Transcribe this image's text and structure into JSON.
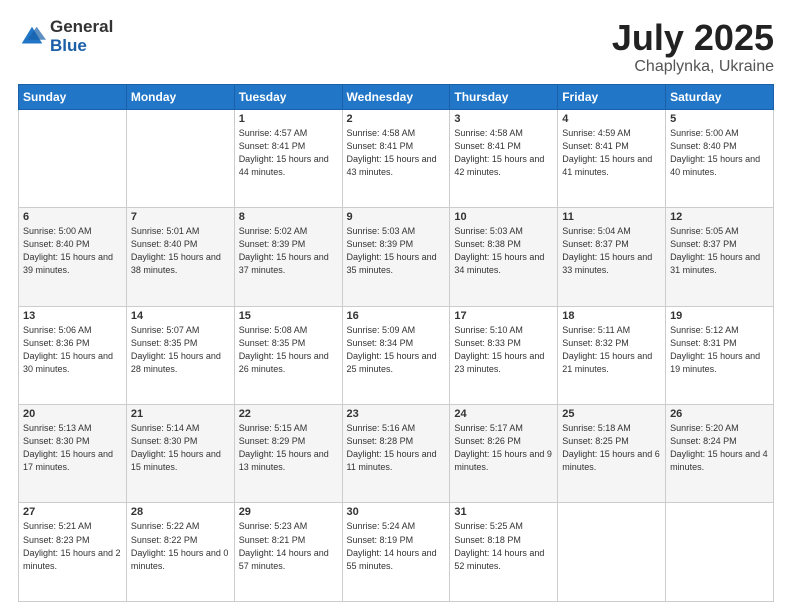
{
  "logo": {
    "general": "General",
    "blue": "Blue"
  },
  "title": {
    "month": "July 2025",
    "location": "Chaplynka, Ukraine"
  },
  "weekdays": [
    "Sunday",
    "Monday",
    "Tuesday",
    "Wednesday",
    "Thursday",
    "Friday",
    "Saturday"
  ],
  "weeks": [
    [
      {
        "day": "",
        "info": ""
      },
      {
        "day": "",
        "info": ""
      },
      {
        "day": "1",
        "info": "Sunrise: 4:57 AM\nSunset: 8:41 PM\nDaylight: 15 hours\nand 44 minutes."
      },
      {
        "day": "2",
        "info": "Sunrise: 4:58 AM\nSunset: 8:41 PM\nDaylight: 15 hours\nand 43 minutes."
      },
      {
        "day": "3",
        "info": "Sunrise: 4:58 AM\nSunset: 8:41 PM\nDaylight: 15 hours\nand 42 minutes."
      },
      {
        "day": "4",
        "info": "Sunrise: 4:59 AM\nSunset: 8:41 PM\nDaylight: 15 hours\nand 41 minutes."
      },
      {
        "day": "5",
        "info": "Sunrise: 5:00 AM\nSunset: 8:40 PM\nDaylight: 15 hours\nand 40 minutes."
      }
    ],
    [
      {
        "day": "6",
        "info": "Sunrise: 5:00 AM\nSunset: 8:40 PM\nDaylight: 15 hours\nand 39 minutes."
      },
      {
        "day": "7",
        "info": "Sunrise: 5:01 AM\nSunset: 8:40 PM\nDaylight: 15 hours\nand 38 minutes."
      },
      {
        "day": "8",
        "info": "Sunrise: 5:02 AM\nSunset: 8:39 PM\nDaylight: 15 hours\nand 37 minutes."
      },
      {
        "day": "9",
        "info": "Sunrise: 5:03 AM\nSunset: 8:39 PM\nDaylight: 15 hours\nand 35 minutes."
      },
      {
        "day": "10",
        "info": "Sunrise: 5:03 AM\nSunset: 8:38 PM\nDaylight: 15 hours\nand 34 minutes."
      },
      {
        "day": "11",
        "info": "Sunrise: 5:04 AM\nSunset: 8:37 PM\nDaylight: 15 hours\nand 33 minutes."
      },
      {
        "day": "12",
        "info": "Sunrise: 5:05 AM\nSunset: 8:37 PM\nDaylight: 15 hours\nand 31 minutes."
      }
    ],
    [
      {
        "day": "13",
        "info": "Sunrise: 5:06 AM\nSunset: 8:36 PM\nDaylight: 15 hours\nand 30 minutes."
      },
      {
        "day": "14",
        "info": "Sunrise: 5:07 AM\nSunset: 8:35 PM\nDaylight: 15 hours\nand 28 minutes."
      },
      {
        "day": "15",
        "info": "Sunrise: 5:08 AM\nSunset: 8:35 PM\nDaylight: 15 hours\nand 26 minutes."
      },
      {
        "day": "16",
        "info": "Sunrise: 5:09 AM\nSunset: 8:34 PM\nDaylight: 15 hours\nand 25 minutes."
      },
      {
        "day": "17",
        "info": "Sunrise: 5:10 AM\nSunset: 8:33 PM\nDaylight: 15 hours\nand 23 minutes."
      },
      {
        "day": "18",
        "info": "Sunrise: 5:11 AM\nSunset: 8:32 PM\nDaylight: 15 hours\nand 21 minutes."
      },
      {
        "day": "19",
        "info": "Sunrise: 5:12 AM\nSunset: 8:31 PM\nDaylight: 15 hours\nand 19 minutes."
      }
    ],
    [
      {
        "day": "20",
        "info": "Sunrise: 5:13 AM\nSunset: 8:30 PM\nDaylight: 15 hours\nand 17 minutes."
      },
      {
        "day": "21",
        "info": "Sunrise: 5:14 AM\nSunset: 8:30 PM\nDaylight: 15 hours\nand 15 minutes."
      },
      {
        "day": "22",
        "info": "Sunrise: 5:15 AM\nSunset: 8:29 PM\nDaylight: 15 hours\nand 13 minutes."
      },
      {
        "day": "23",
        "info": "Sunrise: 5:16 AM\nSunset: 8:28 PM\nDaylight: 15 hours\nand 11 minutes."
      },
      {
        "day": "24",
        "info": "Sunrise: 5:17 AM\nSunset: 8:26 PM\nDaylight: 15 hours\nand 9 minutes."
      },
      {
        "day": "25",
        "info": "Sunrise: 5:18 AM\nSunset: 8:25 PM\nDaylight: 15 hours\nand 6 minutes."
      },
      {
        "day": "26",
        "info": "Sunrise: 5:20 AM\nSunset: 8:24 PM\nDaylight: 15 hours\nand 4 minutes."
      }
    ],
    [
      {
        "day": "27",
        "info": "Sunrise: 5:21 AM\nSunset: 8:23 PM\nDaylight: 15 hours\nand 2 minutes."
      },
      {
        "day": "28",
        "info": "Sunrise: 5:22 AM\nSunset: 8:22 PM\nDaylight: 15 hours\nand 0 minutes."
      },
      {
        "day": "29",
        "info": "Sunrise: 5:23 AM\nSunset: 8:21 PM\nDaylight: 14 hours\nand 57 minutes."
      },
      {
        "day": "30",
        "info": "Sunrise: 5:24 AM\nSunset: 8:19 PM\nDaylight: 14 hours\nand 55 minutes."
      },
      {
        "day": "31",
        "info": "Sunrise: 5:25 AM\nSunset: 8:18 PM\nDaylight: 14 hours\nand 52 minutes."
      },
      {
        "day": "",
        "info": ""
      },
      {
        "day": "",
        "info": ""
      }
    ]
  ]
}
